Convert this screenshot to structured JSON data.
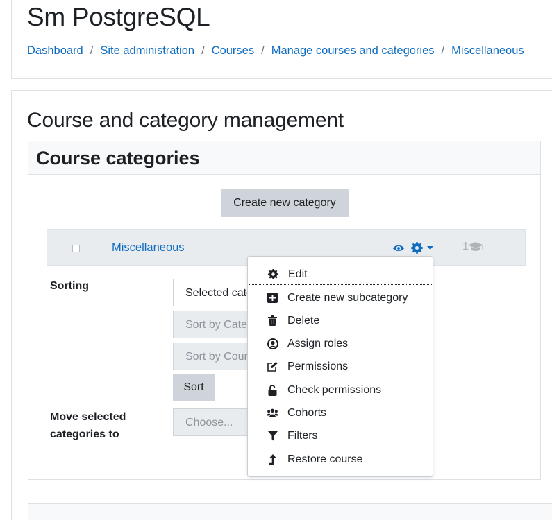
{
  "site": {
    "title": "Sm PostgreSQL"
  },
  "breadcrumb": [
    {
      "label": "Dashboard"
    },
    {
      "label": "Site administration"
    },
    {
      "label": "Courses"
    },
    {
      "label": "Manage courses and categories"
    },
    {
      "label": "Miscellaneous"
    }
  ],
  "breadcrumb_separator": "/",
  "page": {
    "heading": "Course and category management"
  },
  "categories_panel": {
    "title": "Course categories",
    "create_button": "Create new category",
    "row": {
      "name": "Miscellaneous",
      "course_count": "1"
    }
  },
  "sorting": {
    "label": "Sorting",
    "select_value": "Selected categories",
    "sort_by_category": "Sort by Category name",
    "sort_by_course": "Sort by Course full name",
    "sort_button": "Sort"
  },
  "move": {
    "label": "Move selected categories to",
    "choose": "Choose..."
  },
  "menu": {
    "items": [
      {
        "label": "Edit",
        "icon": "gear-icon"
      },
      {
        "label": "Create new subcategory",
        "icon": "plus-square-icon"
      },
      {
        "label": "Delete",
        "icon": "trash-icon"
      },
      {
        "label": "Assign roles",
        "icon": "user-circle-icon"
      },
      {
        "label": "Permissions",
        "icon": "edit-icon"
      },
      {
        "label": "Check permissions",
        "icon": "unlock-icon"
      },
      {
        "label": "Cohorts",
        "icon": "users-icon"
      },
      {
        "label": "Filters",
        "icon": "filter-icon"
      },
      {
        "label": "Restore course",
        "icon": "level-up-icon"
      }
    ]
  },
  "colors": {
    "link": "#0f6cbf",
    "row_bg": "#e9ecef",
    "button_bg": "#ced4da"
  }
}
